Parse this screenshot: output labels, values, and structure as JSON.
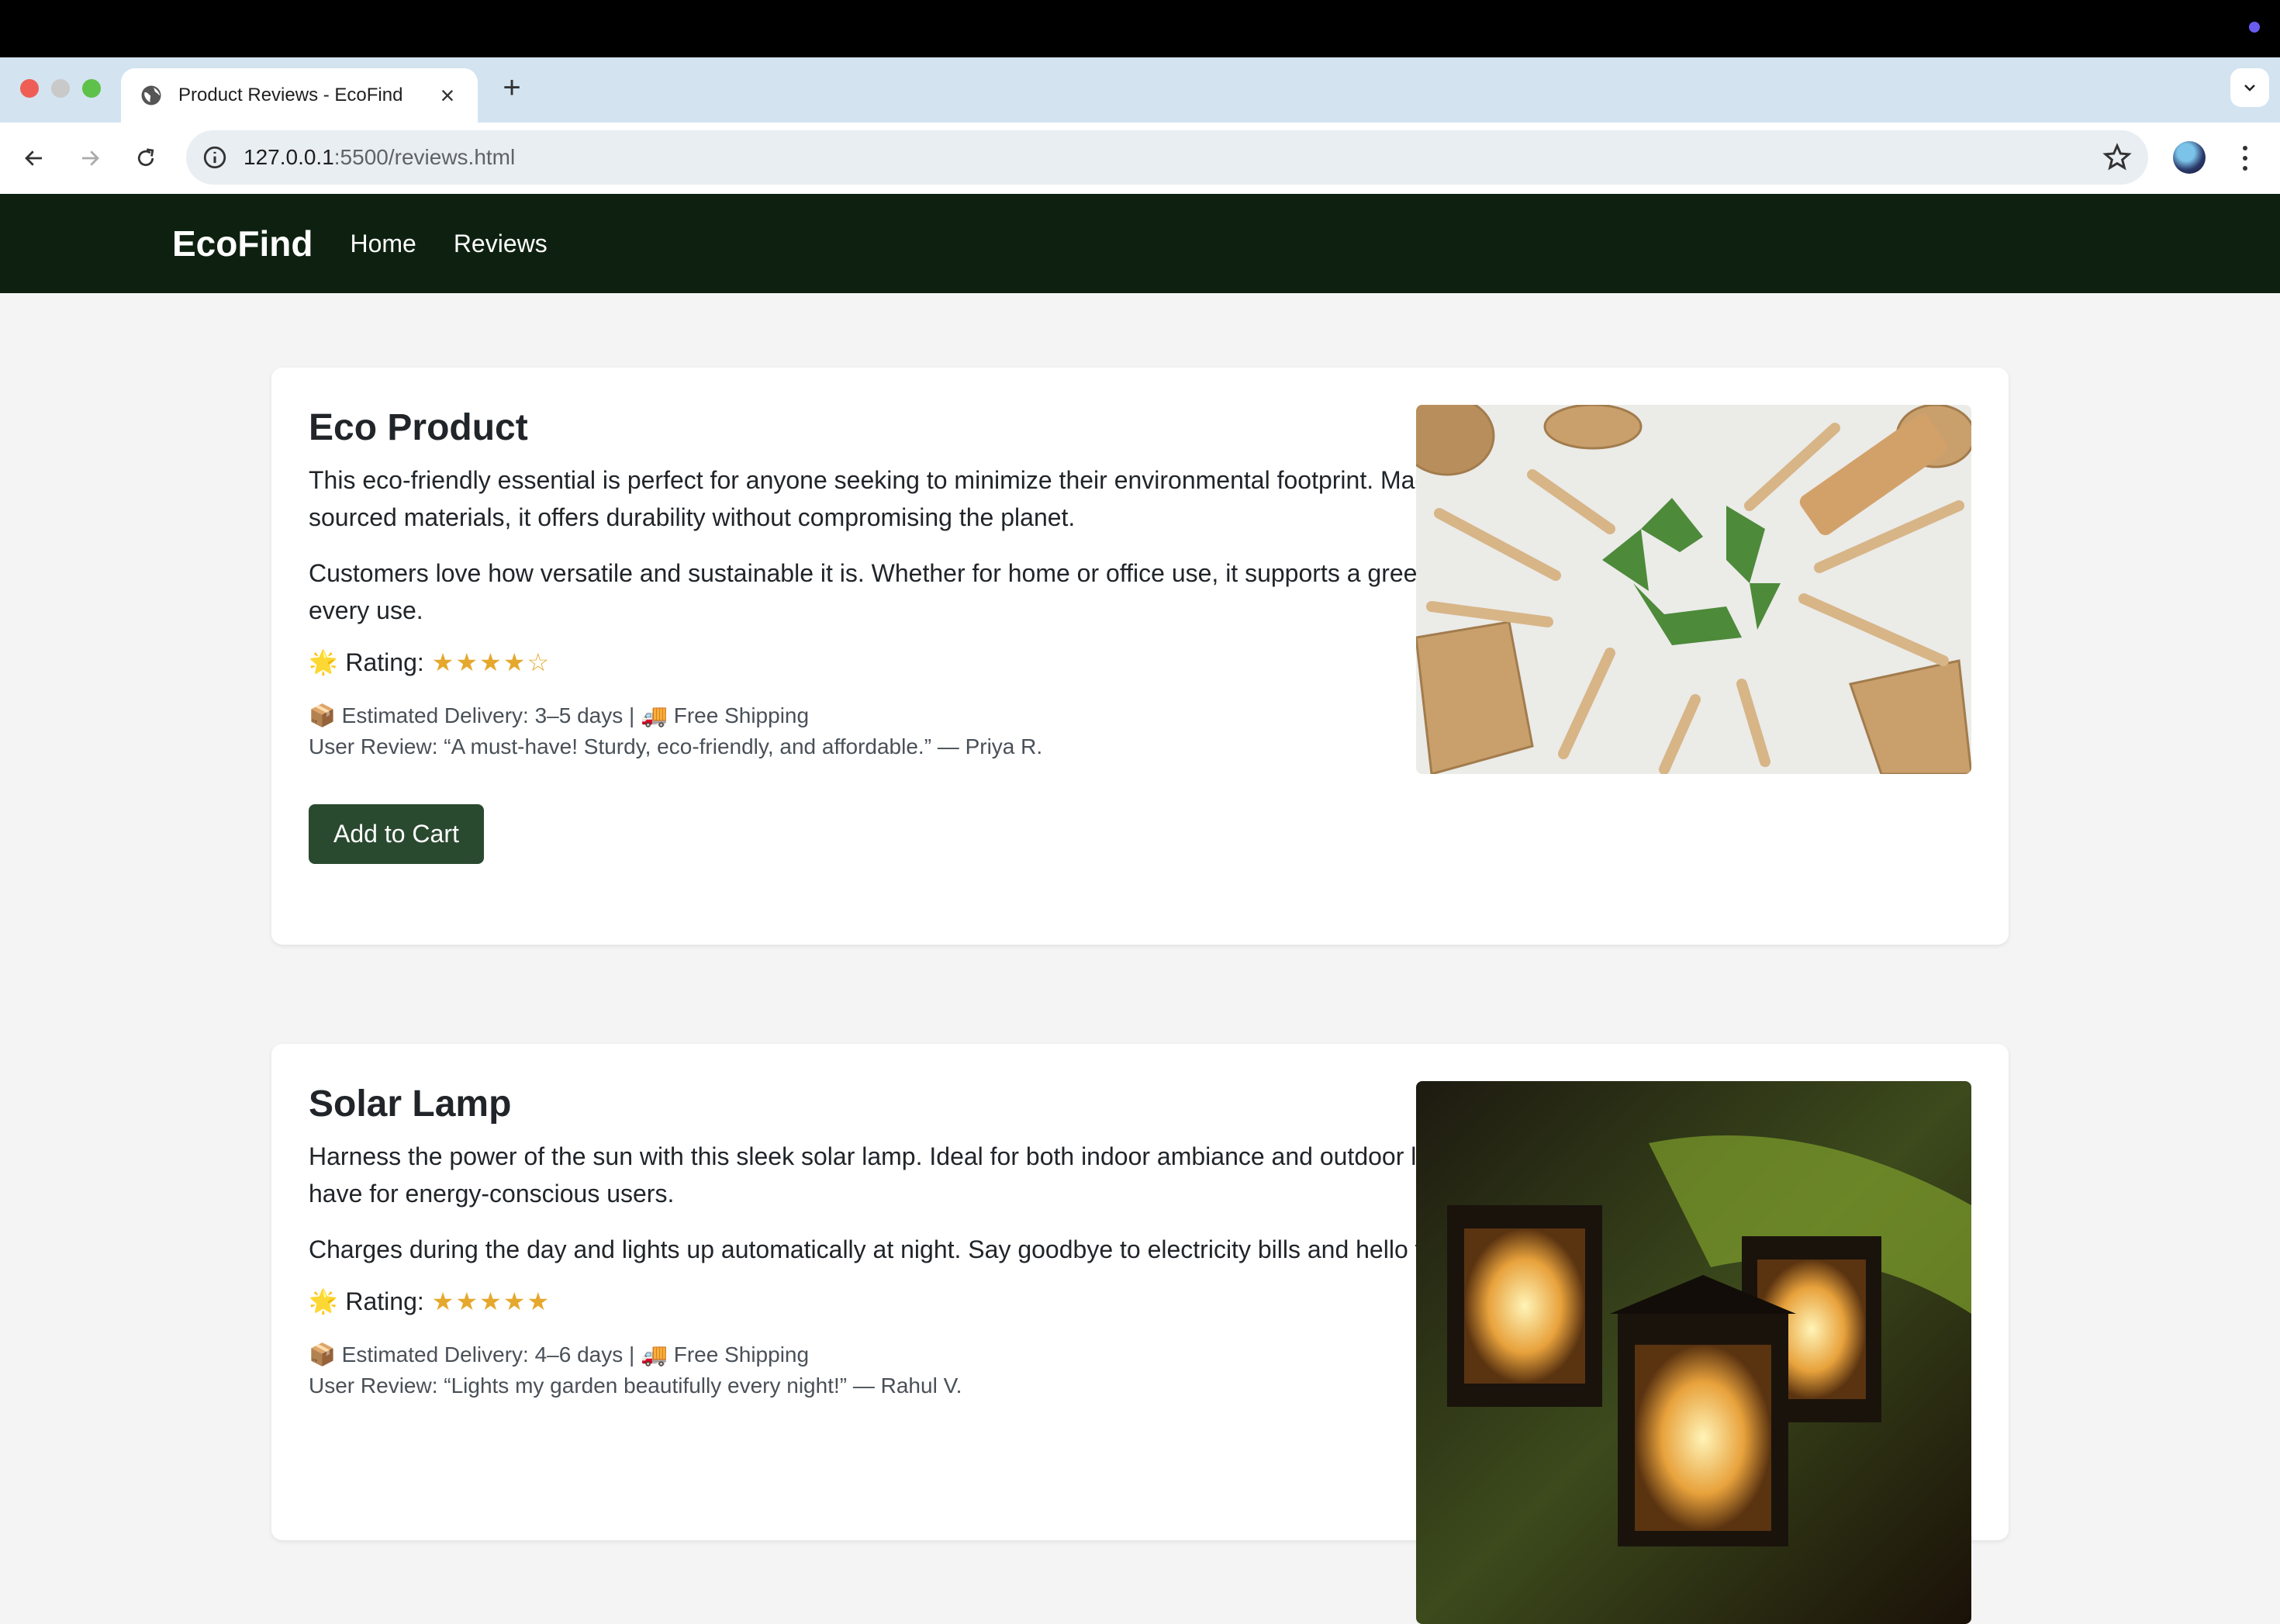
{
  "browser": {
    "tab_title": "Product Reviews - EcoFind",
    "url_host": "127.0.0.1",
    "url_path": ":5500/reviews.html"
  },
  "site": {
    "brand": "EcoFind",
    "nav": [
      "Home",
      "Reviews"
    ]
  },
  "products": [
    {
      "title": "Eco Product",
      "desc1": "This eco-friendly essential is perfect for anyone seeking to minimize their environmental footprint. Made from responsibly sourced materials, it offers durability without compromising the planet.",
      "desc2": "Customers love how versatile and sustainable it is. Whether for home or office use, it supports a greener lifestyle with every use.",
      "rating_label": "Rating:",
      "stars": "★★★★☆",
      "delivery": "📦 Estimated Delivery: 3–5 days | 🚚 Free Shipping",
      "review": "User Review: “A must-have! Sturdy, eco-friendly, and affordable.” — Priya R.",
      "button": "Add to Cart"
    },
    {
      "title": "Solar Lamp",
      "desc1": "Harness the power of the sun with this sleek solar lamp. Ideal for both indoor ambiance and outdoor lighting, it's a must-have for energy-conscious users.",
      "desc2": "Charges during the day and lights up automatically at night. Say goodbye to electricity bills and hello to clean energy.",
      "rating_label": "Rating:",
      "stars": "★★★★★",
      "delivery": "📦 Estimated Delivery: 4–6 days | 🚚 Free Shipping",
      "review": "User Review: “Lights my garden beautifully every night!” — Rahul V."
    }
  ],
  "colors": {
    "nav_bg": "#0e2110",
    "button_bg": "#2a4a30",
    "star": "#e5a82d"
  }
}
